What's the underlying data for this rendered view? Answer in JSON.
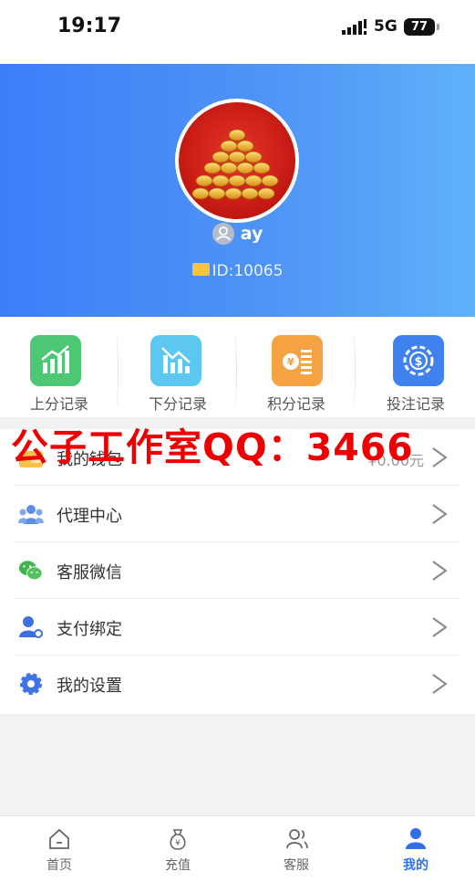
{
  "status_bar": {
    "time": "19:17",
    "network": "5G",
    "battery": "77"
  },
  "profile": {
    "username": "ay",
    "user_id": "ID:10065"
  },
  "quick_actions": [
    {
      "label": "上分记录",
      "icon": "chart-up-icon",
      "color": "#4cc774"
    },
    {
      "label": "下分记录",
      "icon": "chart-down-icon",
      "color": "#5cc8ef"
    },
    {
      "label": "积分记录",
      "icon": "coin-list-icon",
      "color": "#f5a342"
    },
    {
      "label": "投注记录",
      "icon": "chip-icon",
      "color": "#3f82ef"
    }
  ],
  "menu": [
    {
      "label": "我的钱包",
      "value": "¥0.00元",
      "icon": "wallet-icon"
    },
    {
      "label": "代理中心",
      "value": "",
      "icon": "agents-icon"
    },
    {
      "label": "客服微信",
      "value": "",
      "icon": "wechat-icon"
    },
    {
      "label": "支付绑定",
      "value": "",
      "icon": "payment-bind-icon"
    },
    {
      "label": "我的设置",
      "value": "",
      "icon": "settings-gear-icon"
    }
  ],
  "watermark": "公子工作室QQ：3466",
  "tabbar": [
    {
      "label": "首页",
      "icon": "home-icon"
    },
    {
      "label": "充值",
      "icon": "money-bag-icon"
    },
    {
      "label": "客服",
      "icon": "customer-service-icon"
    },
    {
      "label": "我的",
      "icon": "profile-icon",
      "active": true
    }
  ],
  "colors": {
    "header_start": "#3c7ef8",
    "header_end": "#5fb1fa",
    "active_tab": "#2f6fe8",
    "watermark": "#ee0000"
  }
}
